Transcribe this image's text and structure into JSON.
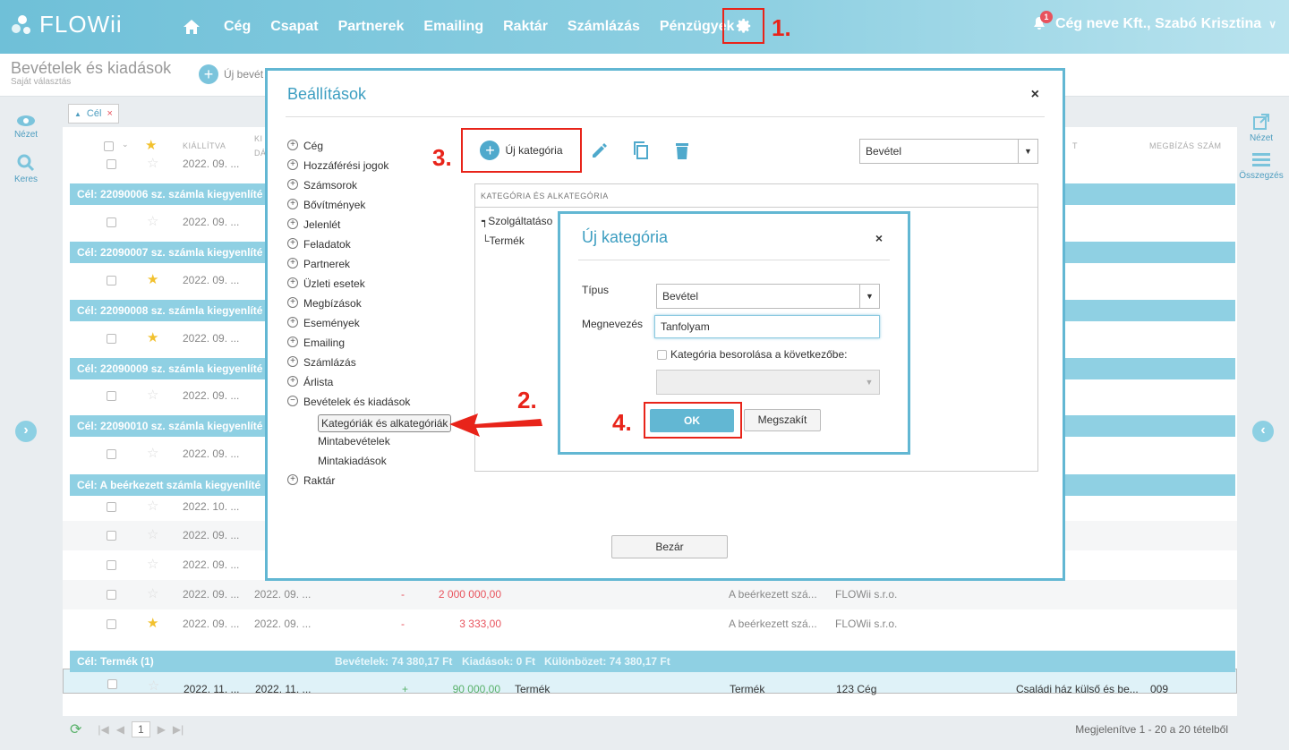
{
  "app": {
    "logo": "FLOWii",
    "nav": [
      "Cég",
      "Csapat",
      "Partnerek",
      "Emailing",
      "Raktár",
      "Számlázás",
      "Pénzügyek"
    ],
    "user": "Cég neve Kft., Szabó Krisztina",
    "notif_count": "1"
  },
  "page": {
    "title": "Bevételek és kiadások",
    "subtitle": "Saját választás",
    "new_label": "Új bevét"
  },
  "left": {
    "view": "Nézet",
    "search": "Keres"
  },
  "right": {
    "view": "Nézet",
    "summary": "Összegzés"
  },
  "filter": {
    "label": "Cél",
    "remove": "×"
  },
  "grid": {
    "head": {
      "issued": "KIÁLLÍTVA",
      "due_a": "KI",
      "due_b": "DÁ",
      "right_col": "T",
      "order_no": "MEGBÍZÁS SZÁM"
    },
    "groups": [
      {
        "label": "Cél: 22090006 sz. számla kiegyenlíté"
      },
      {
        "label": "Cél: 22090007 sz. számla kiegyenlíté"
      },
      {
        "label": "Cél: 22090008 sz. számla kiegyenlíté"
      },
      {
        "label": "Cél: 22090009 sz. számla kiegyenlíté"
      },
      {
        "label": "Cél: 22090010 sz. számla kiegyenlíté"
      },
      {
        "label": "Cél: A beérkezett számla kiegyenlíté"
      },
      {
        "label": "Cél: Termék (1)",
        "income": "Bevételek: 74 380,17 Ft",
        "expense": "Kiadások: 0 Ft",
        "diff": "Különbözet: 74 380,17 Ft"
      }
    ],
    "rows": [
      {
        "d1": "2022. 09. ...",
        "d2": "",
        "sign": "",
        "amount": "",
        "a": "",
        "b": "",
        "c": "",
        "d": "",
        "e": ""
      },
      {
        "d1": "2022. 09. ...",
        "d2": "",
        "sign": "",
        "amount": "",
        "a": "",
        "b": "",
        "c": "",
        "d": "",
        "e": ""
      },
      {
        "d1": "2022. 09. ...",
        "d2": "",
        "sign": "",
        "amount": "",
        "a": "",
        "b": "",
        "c": "",
        "d": "",
        "e": ""
      },
      {
        "d1": "2022. 09. ...",
        "d2": "",
        "sign": "",
        "amount": "",
        "a": "",
        "b": "",
        "c": "",
        "d": "",
        "e": ""
      },
      {
        "d1": "2022. 09. ...",
        "d2": "",
        "sign": "",
        "amount": "",
        "a": "",
        "b": "",
        "c": "",
        "d": "",
        "e": ""
      },
      {
        "d1": "2022. 09. ...",
        "d2": "",
        "sign": "",
        "amount": "",
        "a": "",
        "b": "",
        "c": "",
        "d": "",
        "e": ""
      },
      {
        "d1": "2022. 10. ...",
        "d2": "",
        "sign": "",
        "amount": "",
        "a": "",
        "b": "",
        "c": "",
        "d": "",
        "e": ""
      },
      {
        "d1": "2022. 09. ...",
        "d2": "",
        "sign": "",
        "amount": "",
        "a": "",
        "b": "",
        "c": "",
        "d": "",
        "e": ""
      },
      {
        "d1": "2022. 09. ...",
        "d2": "",
        "sign": "",
        "amount": "",
        "a": "",
        "b": "",
        "c": "",
        "d": "",
        "e": ""
      },
      {
        "d1": "2022. 09. ...",
        "d2": "2022. 09. ...",
        "sign": "-",
        "amount": "2 000 000,00",
        "a": "",
        "b": "A beérkezett szá...",
        "c": "FLOWii s.r.o.",
        "d": "",
        "e": ""
      },
      {
        "d1": "2022. 09. ...",
        "d2": "2022. 09. ...",
        "sign": "-",
        "amount": "3 333,00",
        "a": "",
        "b": "A beérkezett szá...",
        "c": "FLOWii s.r.o.",
        "d": "",
        "e": ""
      },
      {
        "d1": "2022. 11. ...",
        "d2": "2022. 11. ...",
        "sign": "+",
        "amount": "90 000,00",
        "a": "Termék",
        "b": "Termék",
        "c": "123 Cég",
        "d": "Családi ház külső és be...",
        "e": "009"
      }
    ]
  },
  "pager": {
    "page": "1",
    "info": "Megjelenítve 1 - 20 a 20 tételből"
  },
  "settings": {
    "title": "Beállítások",
    "close": "×",
    "tree": [
      "Cég",
      "Hozzáférési jogok",
      "Számsorok",
      "Bővítmények",
      "Jelenlét",
      "Feladatok",
      "Partnerek",
      "Üzleti esetek",
      "Megbízások",
      "Események",
      "Emailing",
      "Számlázás",
      "Árlista",
      "Bevételek és kiadások"
    ],
    "subtree": [
      "Kategóriák és alkategóriák",
      "Mintabevételek",
      "Mintakiadások"
    ],
    "last": "Raktár",
    "new_category": "Új kategória",
    "type_select": "Bevétel",
    "cat_head": "KATEGÓRIA ÉS ALKATEGÓRIA",
    "cats": [
      "Szolgáltatáso",
      "Termék"
    ],
    "close_btn": "Bezár"
  },
  "newcat": {
    "title": "Új kategória",
    "close": "×",
    "type_label": "Típus",
    "type_value": "Bevétel",
    "name_label": "Megnevezés",
    "name_value": "Tanfolyam",
    "checkbox_label": "Kategória besorolása a következőbe:",
    "ok": "OK",
    "cancel": "Megszakít"
  },
  "steps": {
    "s1": "1.",
    "s2": "2.",
    "s3": "3.",
    "s4": "4."
  },
  "colors": {
    "accent": "#62b7d3",
    "step_red": "#e8241a",
    "header": "#8fd0e3"
  }
}
